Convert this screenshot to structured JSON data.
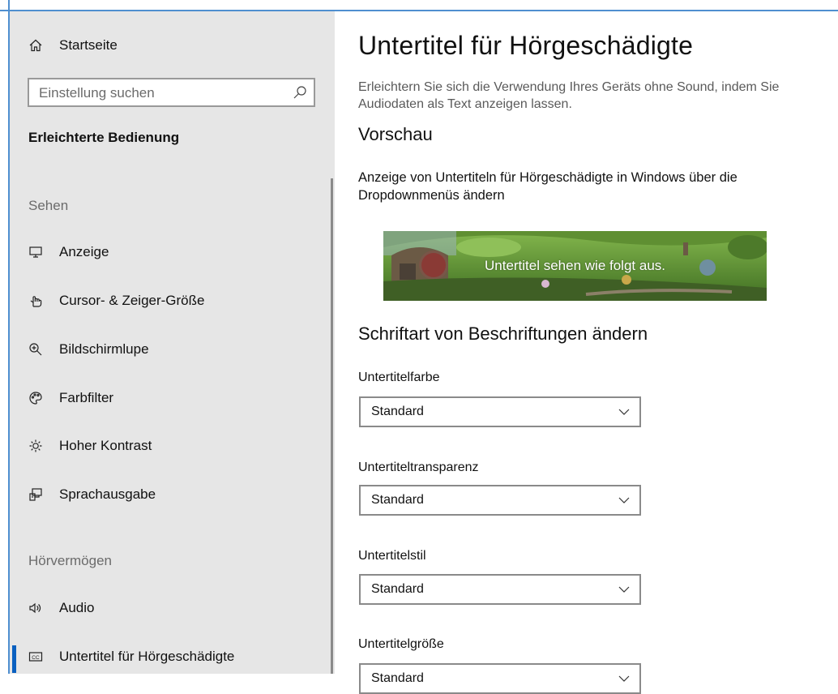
{
  "sidebar": {
    "home_label": "Startseite",
    "search_placeholder": "Einstellung suchen",
    "section_title": "Erleichterte Bedienung",
    "groups": {
      "sehen": "Sehen",
      "hoervermoegen": "Hörvermögen"
    },
    "items": [
      {
        "label": "Anzeige",
        "icon": "monitor-icon"
      },
      {
        "label": "Cursor- & Zeiger-Größe",
        "icon": "pointer-icon"
      },
      {
        "label": "Bildschirmlupe",
        "icon": "magnifier-icon"
      },
      {
        "label": "Farbfilter",
        "icon": "palette-icon"
      },
      {
        "label": "Hoher Kontrast",
        "icon": "sun-icon"
      },
      {
        "label": "Sprachausgabe",
        "icon": "narrator-icon"
      },
      {
        "label": "Audio",
        "icon": "speaker-icon"
      },
      {
        "label": "Untertitel für Hörgeschädigte",
        "icon": "cc-icon",
        "selected": true
      }
    ]
  },
  "main": {
    "title": "Untertitel für Hörgeschädigte",
    "description": "Erleichtern Sie sich die Verwendung Ihres Geräts ohne Sound, indem Sie Audiodaten als Text anzeigen lassen.",
    "preview_heading": "Vorschau",
    "preview_description": "Anzeige von Untertiteln für Hörgeschädigte in Windows über die Dropdownmenüs ändern",
    "preview_caption": "Untertitel sehen wie folgt aus.",
    "font_heading": "Schriftart von Beschriftungen ändern",
    "fields": [
      {
        "label": "Untertitelfarbe",
        "value": "Standard"
      },
      {
        "label": "Untertiteltransparenz",
        "value": "Standard"
      },
      {
        "label": "Untertitelstil",
        "value": "Standard"
      },
      {
        "label": "Untertitelgröße",
        "value": "Standard"
      }
    ]
  },
  "colors": {
    "accent": "#0a60c0",
    "sidebar_bg": "#e6e6e6"
  }
}
